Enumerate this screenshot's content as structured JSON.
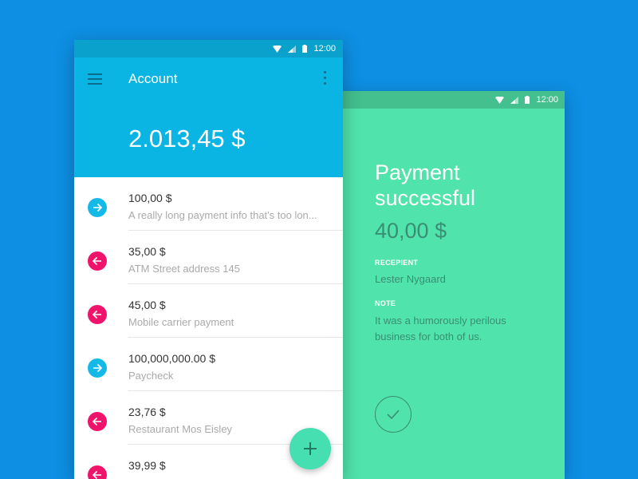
{
  "account_screen": {
    "status_time": "12:00",
    "title": "Account",
    "balance": "2.013,45 $",
    "transactions": [
      {
        "amount": "100,00 $",
        "description": "A really long payment info that's too lon...",
        "direction": "in"
      },
      {
        "amount": "35,00 $",
        "description": "ATM Street address 145",
        "direction": "out"
      },
      {
        "amount": "45,00 $",
        "description": "Mobile carrier payment",
        "direction": "out"
      },
      {
        "amount": "100,000,000.00 $",
        "description": "Paycheck",
        "direction": "in"
      },
      {
        "amount": "23,76 $",
        "description": "Restaurant Mos Eisley",
        "direction": "out"
      },
      {
        "amount": "39,99 $",
        "description": "",
        "direction": "out"
      }
    ],
    "icons": {
      "menu": "menu-icon",
      "more": "more-vert-icon",
      "fab": "add-icon",
      "incoming": "arrow-right-icon",
      "outgoing": "arrow-left-icon"
    }
  },
  "payment_screen": {
    "status_time": "12:00",
    "title": "Payment successful",
    "amount": "40,00 $",
    "recipient_label": "RECEPIENT",
    "recipient": "Lester Nygaard",
    "note_label": "NOTE",
    "note": "It was a humorously perilous business for both of us.",
    "icons": {
      "confirm": "check-icon"
    }
  },
  "colors": {
    "background": "#0e8fe3",
    "account_header": "#0ab4e3",
    "payment_background": "#51e3ac",
    "incoming": "#15b9e8",
    "outgoing": "#f0136b",
    "fab": "#45dfb1"
  }
}
